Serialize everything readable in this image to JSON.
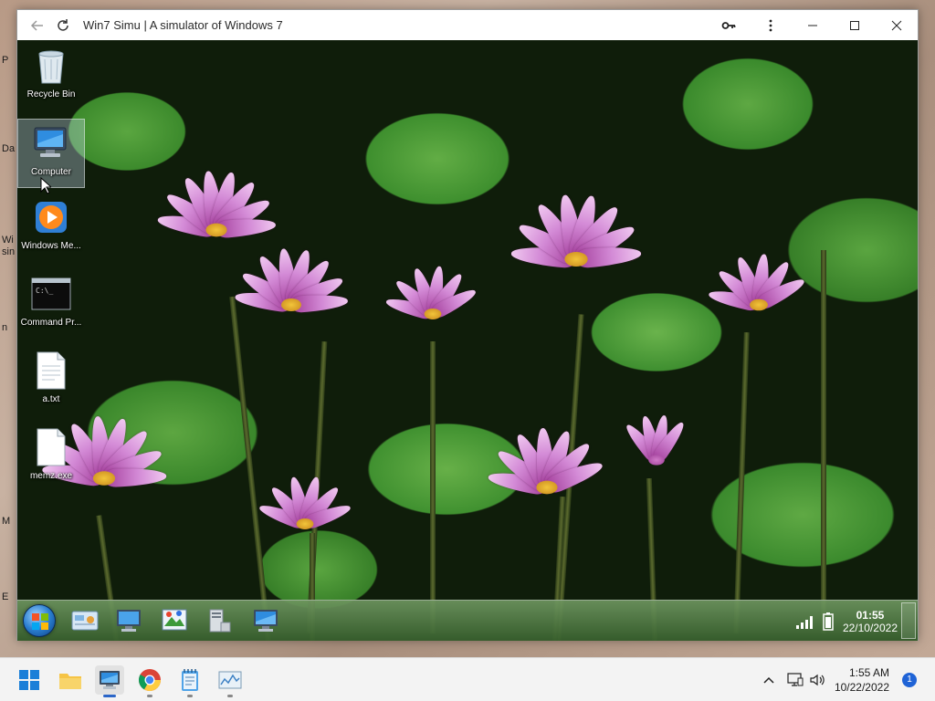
{
  "host_edge_labels": [
    "P",
    "Da",
    "Wi",
    "sin",
    "n",
    "M",
    "E"
  ],
  "app": {
    "title": "Win7 Simu | A simulator of Windows 7"
  },
  "desktop_icons": [
    {
      "label": "Recycle Bin",
      "icon": "recycle-bin-icon"
    },
    {
      "label": "Computer",
      "icon": "computer-icon",
      "selected": true
    },
    {
      "label": "Windows Me...",
      "icon": "windows-media-player-icon"
    },
    {
      "label": "Command Pr...",
      "icon": "command-prompt-icon"
    },
    {
      "label": "a.txt",
      "icon": "text-file-icon"
    },
    {
      "label": "memz.exe",
      "icon": "executable-file-icon"
    }
  ],
  "sim_taskbar": {
    "apps": [
      "control-panel-icon",
      "computer-icon",
      "paint-icon",
      "server-icon",
      "computer-icon"
    ],
    "time": "01:55",
    "date": "22/10/2022"
  },
  "host_taskbar": {
    "apps": [
      "windows-start-icon",
      "file-explorer-icon",
      "win7-simu-icon",
      "chrome-icon",
      "notepad-icon",
      "performance-monitor-icon"
    ],
    "time": "1:55 AM",
    "date": "10/22/2022",
    "notification_count": "1"
  }
}
